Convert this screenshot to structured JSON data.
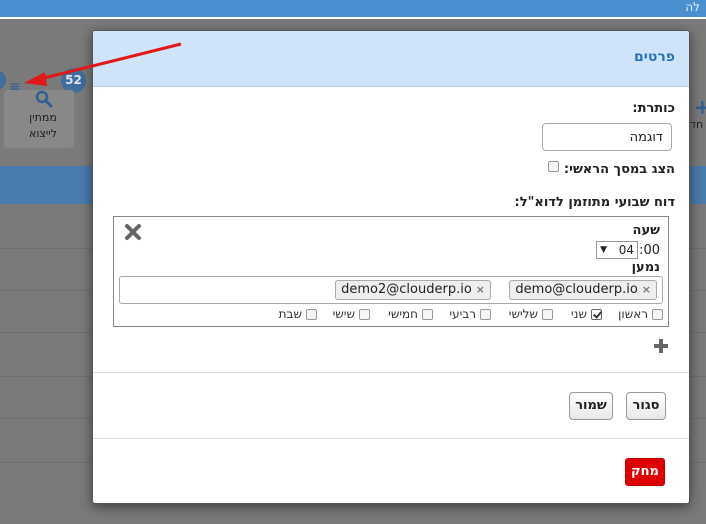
{
  "background": {
    "topbar_text": "לה",
    "badge_count": "52",
    "menu_icon": "hamburger-icon",
    "panel_label_1": "ממתין",
    "panel_label_2": "לייצוא",
    "right_label": "חד"
  },
  "modal": {
    "title": "פרטים",
    "title_label": "כותרת:",
    "title_value": "דוגמה",
    "show_on_home_label": "הצג במסך הראשי:",
    "show_on_home_checked": false,
    "report_label": "דוח שבועי מתוזמן לדוא\"ל:",
    "hour_label": "שעה",
    "hour_value": "04",
    "minutes_value": ":00",
    "recipient_label": "נמען",
    "recipients": [
      "demo@clouderp.io",
      "demo2@clouderp.io"
    ],
    "days": [
      {
        "label": "ראשון",
        "checked": false
      },
      {
        "label": "שני",
        "checked": true
      },
      {
        "label": "שלישי",
        "checked": false
      },
      {
        "label": "רביעי",
        "checked": false
      },
      {
        "label": "חמישי",
        "checked": false
      },
      {
        "label": "שישי",
        "checked": false
      },
      {
        "label": "שבת",
        "checked": false
      }
    ],
    "close_label": "סגור",
    "save_label": "שמור",
    "delete_label": "מחק"
  },
  "colors": {
    "header_bg": "#cfe4fb",
    "title_color": "#2a71b6",
    "delete_bg": "#e00000",
    "annotation_arrow": "#e01818"
  }
}
